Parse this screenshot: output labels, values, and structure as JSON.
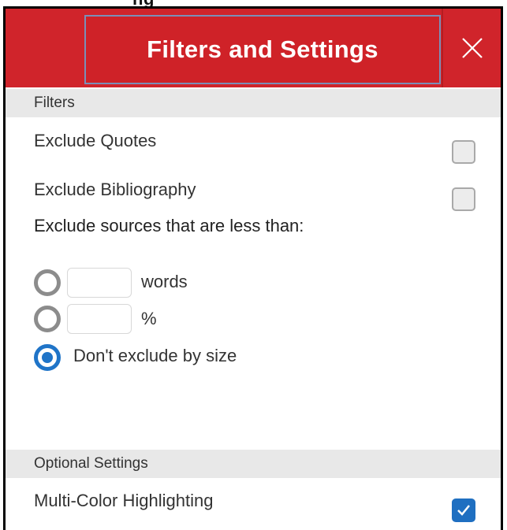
{
  "header": {
    "partial_title": "ng",
    "title": "Filters and Settings",
    "close_icon": "close-icon"
  },
  "filters": {
    "section_label": "Filters",
    "exclude_quotes": {
      "label": "Exclude Quotes",
      "checked": false
    },
    "exclude_bibliography": {
      "label": "Exclude Bibliography",
      "checked": false
    },
    "size_description": "Exclude sources that are less than:",
    "size_options": [
      {
        "value": "",
        "unit": "words",
        "selected": false
      },
      {
        "value": "",
        "unit": "%",
        "selected": false
      },
      {
        "label": "Don't exclude by size",
        "selected": true
      }
    ]
  },
  "optional_settings": {
    "section_label": "Optional Settings",
    "multi_color_highlighting": {
      "label": "Multi-Color Highlighting",
      "checked": true
    }
  },
  "colors": {
    "header_red": "#d0242b",
    "accent_blue": "#1f74c8",
    "section_gray": "#e8e8e8"
  }
}
